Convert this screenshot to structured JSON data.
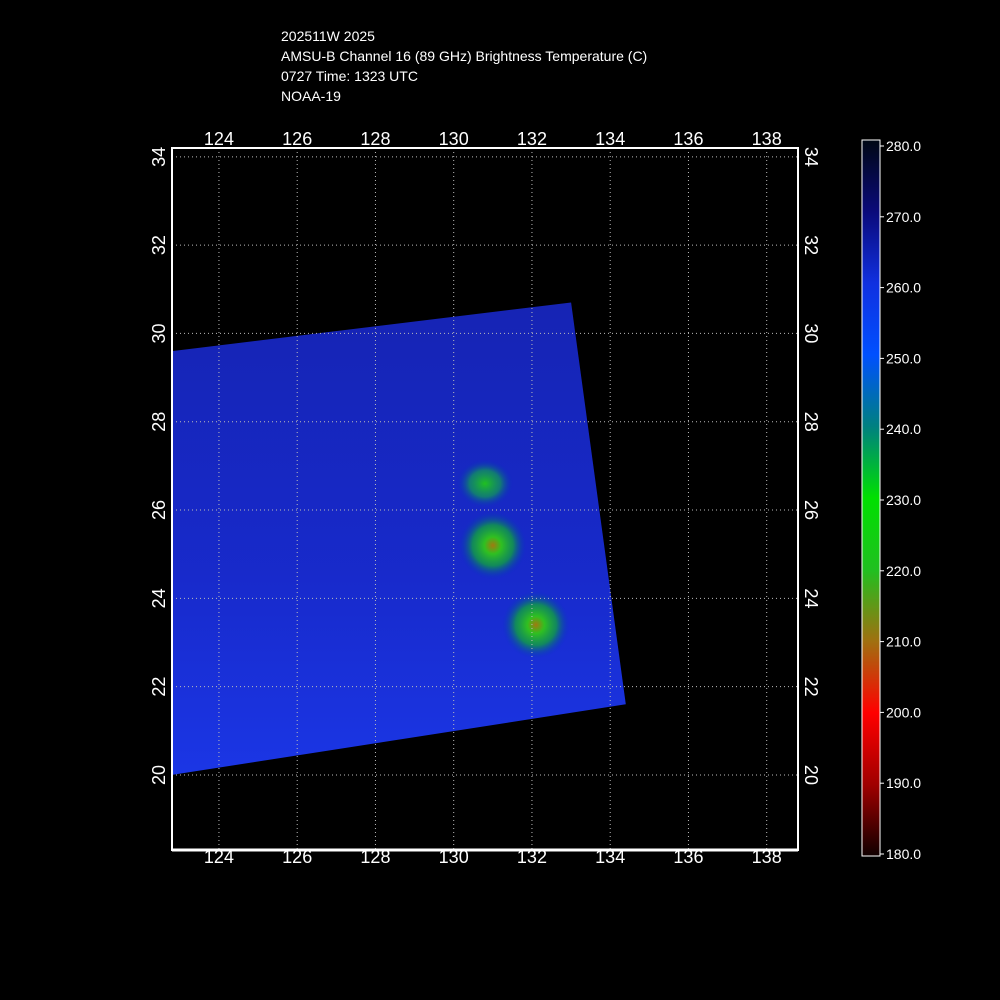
{
  "header": {
    "line1": "202511W 2025",
    "line2": "AMSU-B Channel 16 (89 GHz) Brightness Temperature (C)",
    "line3": "0727 Time: 1323 UTC",
    "line4": "NOAA-19"
  },
  "map": {
    "lon_ticks": [
      "124",
      "126",
      "128",
      "130",
      "132",
      "134",
      "136",
      "138"
    ],
    "lat_ticks": [
      "34",
      "32",
      "30",
      "28",
      "26",
      "24",
      "22",
      "20"
    ],
    "lon_range": [
      122.8,
      138.8
    ],
    "lat_range": [
      18.3,
      34.2
    ],
    "swath_corners_latlon": [
      [
        29.6,
        122.8
      ],
      [
        30.7,
        133.0
      ],
      [
        21.6,
        134.4
      ],
      [
        20.0,
        122.8
      ]
    ],
    "cold_cores": [
      {
        "lat": 26.6,
        "lon": 130.8,
        "min_temp": 233
      },
      {
        "lat": 25.2,
        "lon": 131.0,
        "min_temp": 222
      },
      {
        "lat": 23.4,
        "lon": 132.1,
        "min_temp": 225
      }
    ]
  },
  "colorbar": {
    "labels": [
      "280.0",
      "270.0",
      "260.0",
      "250.0",
      "240.0",
      "230.0",
      "220.0",
      "210.0",
      "200.0",
      "190.0",
      "180.0"
    ],
    "stops": [
      "#000814",
      "#0a0a7a",
      "#1030e0",
      "#0050ff",
      "#008080",
      "#00e000",
      "#20c020",
      "#a07010",
      "#ff0000",
      "#a00000",
      "#100000"
    ]
  },
  "colors": {
    "background": "#000000",
    "frame": "#ffffff",
    "grid": "#bbbbbb"
  }
}
